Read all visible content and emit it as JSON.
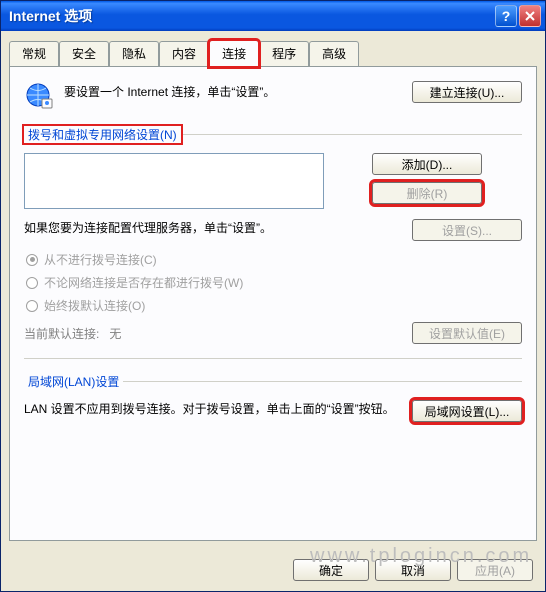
{
  "window": {
    "title": "Internet 选项"
  },
  "tabs": {
    "items": [
      {
        "label": "常规"
      },
      {
        "label": "安全"
      },
      {
        "label": "隐私"
      },
      {
        "label": "内容"
      },
      {
        "label": "连接"
      },
      {
        "label": "程序"
      },
      {
        "label": "高级"
      }
    ]
  },
  "intro": {
    "text": "要设置一个 Internet 连接，单击“设置”。",
    "setup_button": "建立连接(U)..."
  },
  "dialup": {
    "section_label": "拨号和虚拟专用网络设置(N)",
    "add_button": "添加(D)...",
    "remove_button": "删除(R)",
    "settings_button": "设置(S)...",
    "proxy_text": "如果您要为连接配置代理服务器，单击“设置”。",
    "radios": {
      "never": "从不进行拨号连接(C)",
      "when_needed": "不论网络连接是否存在都进行拨号(W)",
      "always_default": "始终拨默认连接(O)"
    },
    "default": {
      "label": "当前默认连接:",
      "value": "无",
      "set_default_button": "设置默认值(E)"
    }
  },
  "lan": {
    "section_label": "局域网(LAN)设置",
    "text": "LAN 设置不应用到拨号连接。对于拨号设置，单击上面的“设置”按钮。",
    "button": "局域网设置(L)..."
  },
  "buttons": {
    "ok": "确定",
    "cancel": "取消",
    "apply": "应用(A)"
  },
  "watermark": "www.tplogincn.com"
}
